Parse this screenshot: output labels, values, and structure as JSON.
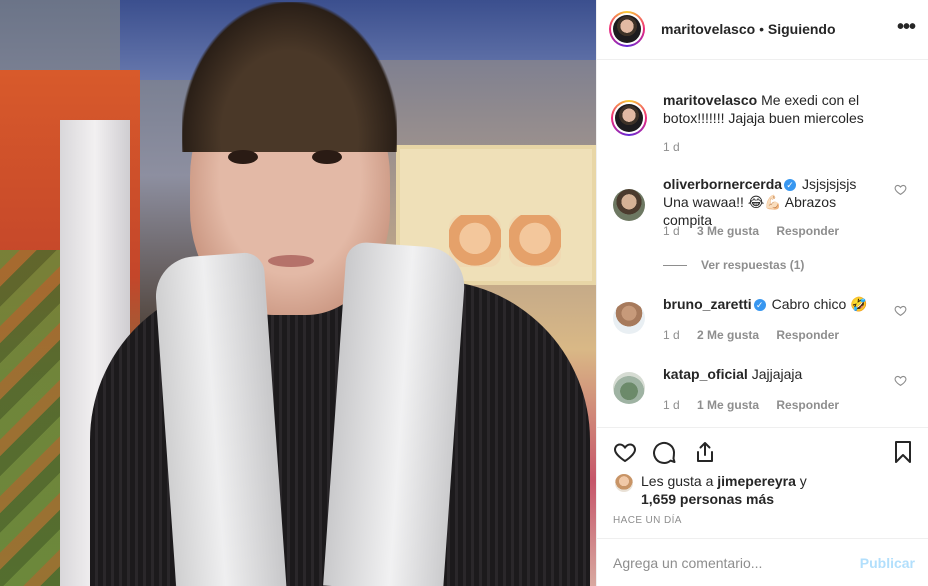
{
  "header": {
    "username": "maritovelasco",
    "separator": "•",
    "follow_status": "Siguiendo",
    "more_icon": "more-horizontal-icon"
  },
  "caption": {
    "username": "maritovelasco",
    "text": "Me exedi con el botox!!!!!!! Jajaja buen miercoles",
    "time": "1 d"
  },
  "comments": [
    {
      "username": "oliverbornercerda",
      "verified": true,
      "text": "Jsjsjsjsjs Una wawaa!! 😂💪🏻 Abrazos compita",
      "time": "1 d",
      "likes": "3 Me gusta",
      "reply_label": "Responder",
      "view_replies": "Ver respuestas (1)"
    },
    {
      "username": "bruno_zaretti",
      "verified": true,
      "text": "Cabro chico 🤣",
      "time": "1 d",
      "likes": "2 Me gusta",
      "reply_label": "Responder"
    },
    {
      "username": "katap_oficial",
      "verified": false,
      "text": "Jajjajaja",
      "time": "1 d",
      "likes": "1 Me gusta",
      "reply_label": "Responder"
    }
  ],
  "likes": {
    "prefix": "Les gusta a",
    "first_user": "jimepereyra",
    "connector": "y",
    "others": "1,659 personas más"
  },
  "posted": "HACE UN DÍA",
  "composer": {
    "placeholder": "Agrega un comentario...",
    "publish_label": "Publicar"
  },
  "colors": {
    "text": "#262626",
    "muted": "#8e8e8e",
    "verified": "#3897f0",
    "publish_disabled": "#b2dffc",
    "border": "#efefef"
  }
}
